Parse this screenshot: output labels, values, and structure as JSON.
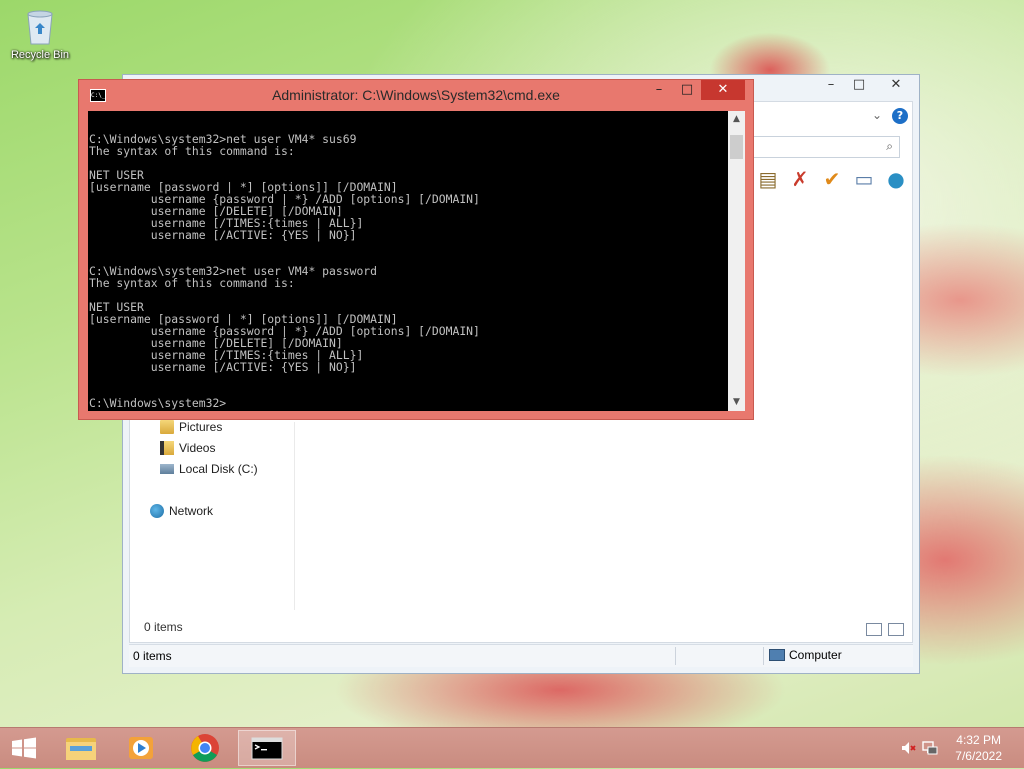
{
  "desktop": {
    "icons": [
      {
        "label": "Recycle Bin",
        "icon": "recycle-bin-icon"
      }
    ]
  },
  "explorer": {
    "title_controls": {
      "minimize": "–",
      "maximize": "□",
      "close": "✕"
    },
    "nav": {
      "pictures": "Pictures",
      "videos": "Videos",
      "local_disk": "Local Disk (C:)",
      "network": "Network"
    },
    "items_count": "0 items",
    "status": {
      "items": "0 items",
      "location": "Computer"
    }
  },
  "cmd": {
    "title": "Administrator: C:\\Windows\\System32\\cmd.exe",
    "controls": {
      "minimize": "–",
      "maximize": "□",
      "close": "✕"
    },
    "icon_text": "C:\\_",
    "console_text": "C:\\Windows\\system32>net user VM4* sus69\nThe syntax of this command is:\n\nNET USER\n[username [password | *] [options]] [/DOMAIN]\n         username {password | *} /ADD [options] [/DOMAIN]\n         username [/DELETE] [/DOMAIN]\n         username [/TIMES:{times | ALL}]\n         username [/ACTIVE: {YES | NO}]\n\n\nC:\\Windows\\system32>net user VM4* password\nThe syntax of this command is:\n\nNET USER\n[username [password | *] [options]] [/DOMAIN]\n         username {password | *} /ADD [options] [/DOMAIN]\n         username [/DELETE] [/DOMAIN]\n         username [/TIMES:{times | ALL}]\n         username [/ACTIVE: {YES | NO}]\n\n\nC:\\Windows\\system32>"
  },
  "taskbar": {
    "apps": [
      {
        "name": "File Explorer",
        "icon": "folder-icon"
      },
      {
        "name": "Windows Media Player",
        "icon": "media-player-icon"
      },
      {
        "name": "Google Chrome",
        "icon": "chrome-icon"
      },
      {
        "name": "Command Prompt",
        "icon": "cmd-icon",
        "active": true
      }
    ],
    "clock": {
      "time": "4:32 PM",
      "date": "7/6/2022"
    }
  }
}
